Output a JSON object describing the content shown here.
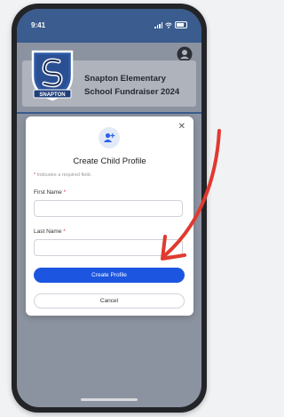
{
  "status_bar": {
    "time": "9:41"
  },
  "header": {
    "logo_text": "SNAPTON",
    "school_line1": "Snapton Elementary",
    "school_line2": "School Fundraiser 2024"
  },
  "modal": {
    "title": "Create Child Profile",
    "required_note_star": "*",
    "required_note": "Indicates a required field.",
    "first_name_label": "First Name",
    "last_name_label": "Last Name",
    "required_star": "*",
    "first_name_value": "",
    "last_name_value": "",
    "create_button": "Create Profile",
    "cancel_button": "Cancel",
    "close_symbol": "✕"
  },
  "colors": {
    "status_blue": "#3a5c8e",
    "primary_button": "#1c56e0",
    "annotation_arrow": "#e03a2f",
    "required_star": "#d8363f"
  }
}
